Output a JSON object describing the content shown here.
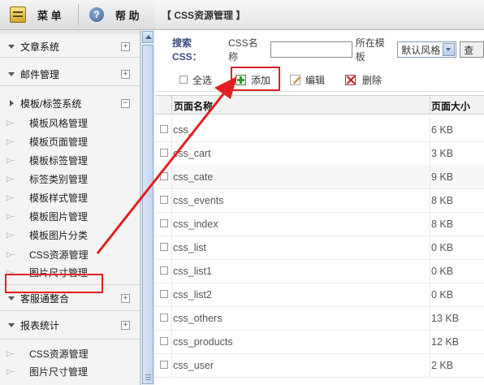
{
  "top": {
    "menu_label": "菜 单",
    "help_label": "帮 助"
  },
  "sidebar": {
    "groups": [
      {
        "label": "文章系统",
        "toggle": "+"
      },
      {
        "label": "邮件管理",
        "toggle": "+"
      },
      {
        "label": "模板/标签系统",
        "toggle": "−",
        "items": [
          "模板风格管理",
          "模板页面管理",
          "模板标签管理",
          "标签类别管理",
          "模板样式管理",
          "模板图片管理",
          "模板图片分类",
          "CSS资源管理",
          "图片尺寸管理"
        ]
      },
      {
        "label": "客服通整合",
        "toggle": "+"
      },
      {
        "label": "报表统计",
        "toggle": "+",
        "items": [
          "CSS资源管理",
          "图片尺寸管理"
        ]
      }
    ]
  },
  "main": {
    "title": "【 CSS资源管理 】",
    "search": {
      "label": "搜索CSS：",
      "name_label": "CSS名称",
      "name_value": "",
      "template_label": "所在模板",
      "template_value": "默认风格",
      "query_label": "查"
    },
    "toolbar": {
      "select_all": "全选",
      "add": "添加",
      "edit": "编辑",
      "delete": "删除"
    },
    "table": {
      "headers": [
        "页面名称",
        "页面大小"
      ],
      "rows": [
        {
          "name": "css_",
          "size": "6 KB"
        },
        {
          "name": "css_cart",
          "size": "3 KB"
        },
        {
          "name": "css_cate",
          "size": "9 KB"
        },
        {
          "name": "css_events",
          "size": "8 KB"
        },
        {
          "name": "css_index",
          "size": "8 KB"
        },
        {
          "name": "css_list",
          "size": "0 KB"
        },
        {
          "name": "css_list1",
          "size": "0 KB"
        },
        {
          "name": "css_list2",
          "size": "0 KB"
        },
        {
          "name": "css_others",
          "size": "13 KB"
        },
        {
          "name": "css_products",
          "size": "12 KB"
        },
        {
          "name": "css_user",
          "size": "2 KB"
        }
      ]
    }
  },
  "colors": {
    "highlight": "#e02020",
    "accent": "#3d4f80"
  }
}
